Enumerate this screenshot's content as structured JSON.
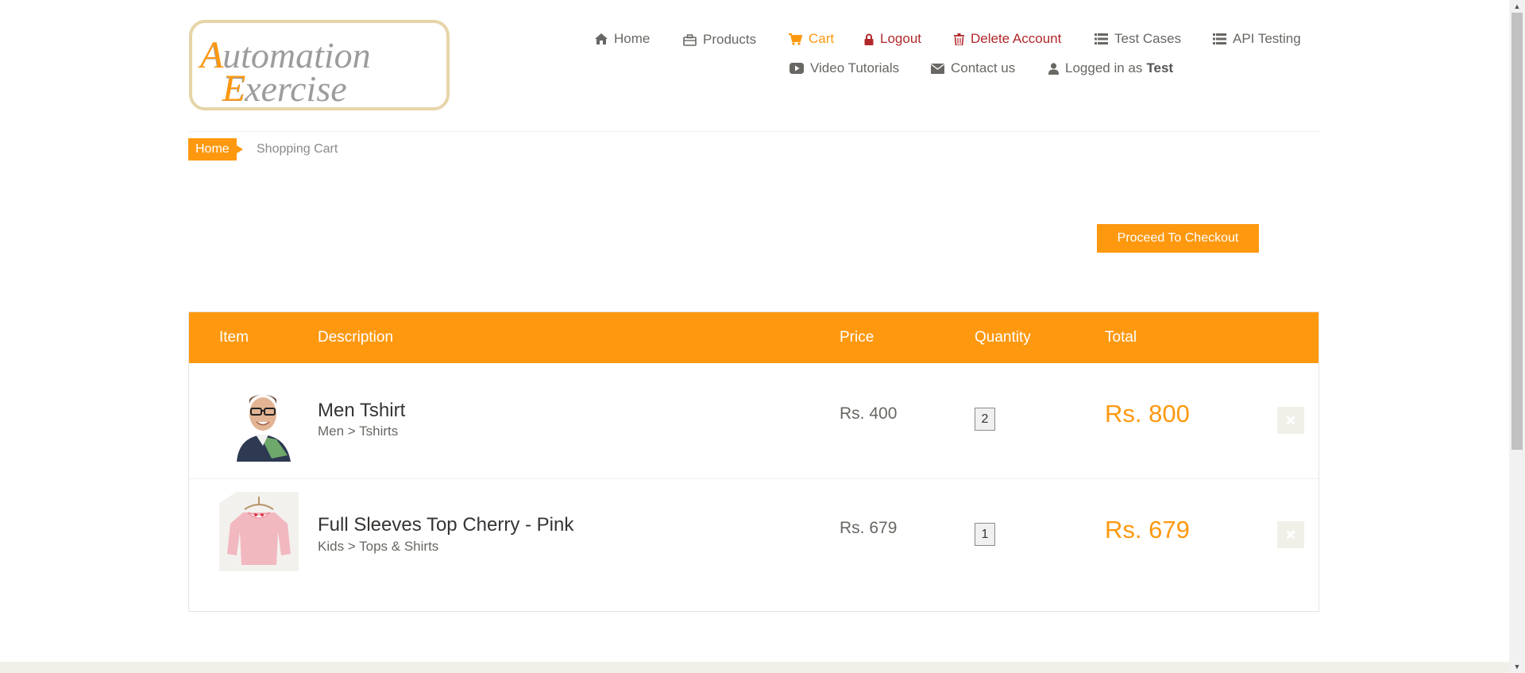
{
  "logo": {
    "line1": "Automation",
    "line2": "Exercise"
  },
  "nav": {
    "home": "Home",
    "products": "Products",
    "cart": "Cart",
    "logout": "Logout",
    "delete_account": "Delete Account",
    "test_cases": "Test Cases",
    "api_testing": "API Testing",
    "video_tutorials": "Video Tutorials",
    "contact_us": "Contact us",
    "logged_in_prefix": "Logged in as",
    "logged_in_user": "Test"
  },
  "breadcrumb": {
    "home": "Home",
    "current": "Shopping Cart"
  },
  "checkout_button": "Proceed To Checkout",
  "cart_table": {
    "headers": {
      "item": "Item",
      "description": "Description",
      "price": "Price",
      "quantity": "Quantity",
      "total": "Total"
    },
    "rows": [
      {
        "name": "Men Tshirt",
        "category": "Men > Tshirts",
        "price": "Rs. 400",
        "quantity": "2",
        "total": "Rs. 800",
        "image_icon": "man-tshirt-photo"
      },
      {
        "name": "Full Sleeves Top Cherry - Pink",
        "category": "Kids > Tops & Shirts",
        "price": "Rs. 679",
        "quantity": "1",
        "total": "Rs. 679",
        "image_icon": "pink-top-photo"
      }
    ]
  },
  "colors": {
    "accent": "#fe980f",
    "danger": "#b2272a",
    "text": "#696763"
  }
}
